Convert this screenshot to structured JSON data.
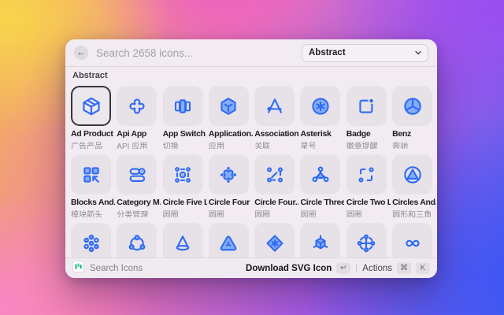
{
  "window": {
    "header": {
      "back_icon_glyph": "←",
      "search_placeholder": "Search 2658 icons...",
      "category_dropdown": {
        "value": "Abstract"
      }
    },
    "section_title": "Abstract",
    "grid": {
      "items": [
        {
          "name": "Ad Product",
          "zh": "广告产品",
          "icon": "ad-product",
          "selected": true
        },
        {
          "name": "Api App",
          "zh": "API 应用",
          "icon": "api-app",
          "selected": false
        },
        {
          "name": "App Switch",
          "zh": "切换",
          "icon": "app-switch",
          "selected": false
        },
        {
          "name": "Application...",
          "zh": "应用",
          "icon": "application",
          "selected": false
        },
        {
          "name": "Association",
          "zh": "关联",
          "icon": "association",
          "selected": false
        },
        {
          "name": "Asterisk",
          "zh": "星号",
          "icon": "asterisk",
          "selected": false
        },
        {
          "name": "Badge",
          "zh": "徽章提醒",
          "icon": "badge",
          "selected": false
        },
        {
          "name": "Benz",
          "zh": "奔驰",
          "icon": "benz",
          "selected": false
        },
        {
          "name": "Blocks And...",
          "zh": "模块箭头",
          "icon": "blocks-and-arrows",
          "selected": false
        },
        {
          "name": "Category M...",
          "zh": "分类管理",
          "icon": "category-management",
          "selected": false
        },
        {
          "name": "Circle Five L...",
          "zh": "圆圈",
          "icon": "circle-five-line",
          "selected": false
        },
        {
          "name": "Circle Four",
          "zh": "圆圈",
          "icon": "circle-four",
          "selected": false
        },
        {
          "name": "Circle Four...",
          "zh": "圆圈",
          "icon": "circle-four-line",
          "selected": false
        },
        {
          "name": "Circle Three",
          "zh": "圆圈",
          "icon": "circle-three",
          "selected": false
        },
        {
          "name": "Circle Two L...",
          "zh": "圆圈",
          "icon": "circle-two-line",
          "selected": false
        },
        {
          "name": "Circles And...",
          "zh": "圆形和三角",
          "icon": "circles-and-triangle",
          "selected": false
        },
        {
          "name": "",
          "zh": "",
          "icon": "dots-seven",
          "selected": false
        },
        {
          "name": "",
          "zh": "",
          "icon": "share-three",
          "selected": false
        },
        {
          "name": "",
          "zh": "",
          "icon": "cone",
          "selected": false
        },
        {
          "name": "",
          "zh": "",
          "icon": "triangle-attention",
          "selected": false
        },
        {
          "name": "",
          "zh": "",
          "icon": "diamond-asterisk",
          "selected": false
        },
        {
          "name": "",
          "zh": "",
          "icon": "cube-rays",
          "selected": false
        },
        {
          "name": "",
          "zh": "",
          "icon": "cross-dots",
          "selected": false
        },
        {
          "name": "",
          "zh": "",
          "icon": "infinity",
          "selected": false
        }
      ]
    },
    "footer": {
      "app_name": "Search Icons",
      "primary_action": {
        "label": "Download SVG Icon",
        "key": "↵"
      },
      "secondary_action": {
        "label": "Actions",
        "keys": [
          "⌘",
          "K"
        ]
      }
    }
  },
  "colors": {
    "accent_blue": "#2E6BF3",
    "icon_fill": "#85ACF8",
    "selected_border": "#38333D",
    "tile_bg": "#E7E1E8",
    "window_bg": "#F2ECF2",
    "logo_green": "#18B580",
    "bg_gradient": [
      "#F8D44C",
      "#FA86C5",
      "#EE5CC2",
      "#9A4CF1",
      "#3C55F3"
    ]
  }
}
